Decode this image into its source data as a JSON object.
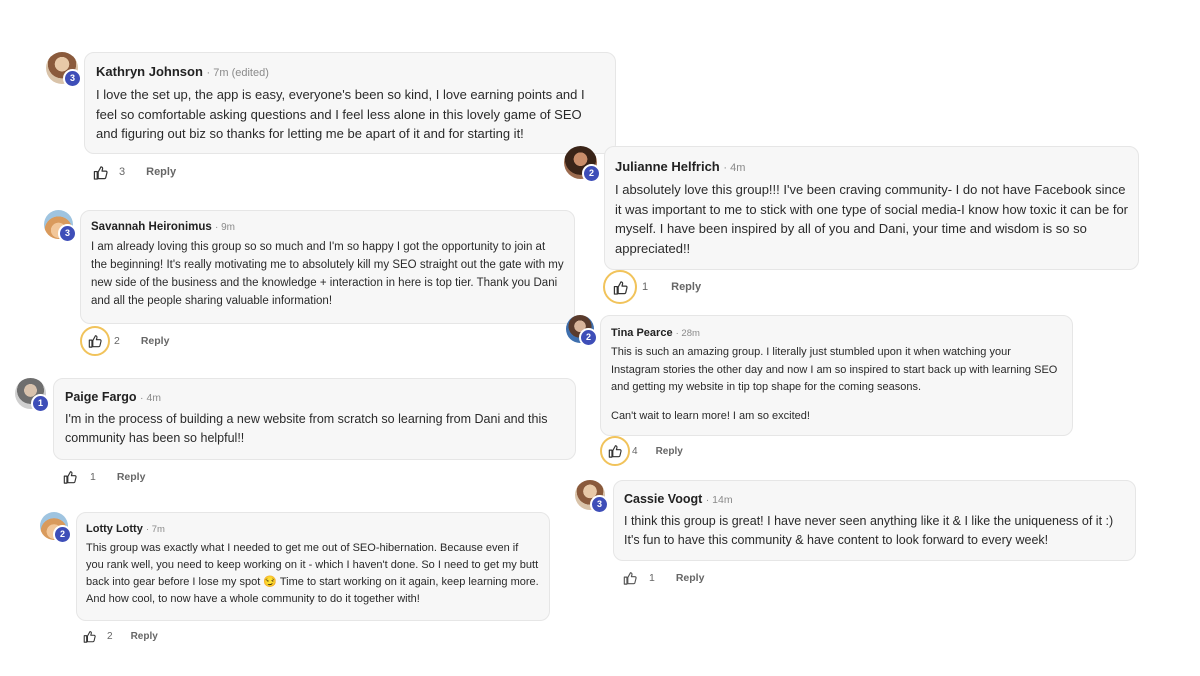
{
  "comments": [
    {
      "author": "Kathryn Johnson",
      "meta": "· 7m (edited)",
      "level": "3",
      "avatar_icon": "profile-photo",
      "text": "I love the set up, the app is easy, everyone's been so kind, I love earning points and I feel so comfortable asking questions and I feel less alone in this lovely game of SEO and figuring out biz so thanks for letting me be apart of it and for starting it!",
      "likes": "3",
      "reply": "Reply"
    },
    {
      "author": "Savannah Heironimus",
      "meta": "· 9m",
      "level": "3",
      "avatar_icon": "profile-photo",
      "text": "I am already loving this group so so much and I'm so happy I got the opportunity to join at the beginning! It's really motivating me to absolutely kill my SEO straight out the gate with my new side of the business and the knowledge + interaction in here is top tier. Thank you Dani and all the people sharing valuable information!",
      "likes": "2",
      "reply": "Reply"
    },
    {
      "author": "Paige Fargo",
      "meta": "· 4m",
      "level": "1",
      "avatar_icon": "profile-photo",
      "text": "I'm in the process of building a new website from scratch so learning from Dani and this community has been so helpful!!",
      "likes": "1",
      "reply": "Reply"
    },
    {
      "author": "Lotty Lotty",
      "meta": "· 7m",
      "level": "2",
      "avatar_icon": "profile-photo",
      "text": "This group was exactly what I needed to get me out of SEO-hibernation. Because even if you rank well, you need to keep working on it - which I haven't done. So I need to get my butt back into gear before I lose my spot 😏 Time to start working on it again, keep learning more. And how cool, to now have a whole community to do it together with!",
      "likes": "2",
      "reply": "Reply"
    },
    {
      "author": "Julianne Helfrich",
      "meta": "· 4m",
      "level": "2",
      "avatar_icon": "profile-photo",
      "text": "I absolutely love this group!!! I've been craving community- I do not have Facebook since it was important to me to stick with one type of social media-I know how toxic it can be for myself. I have been inspired by all of you and Dani, your time and wisdom is so so appreciated!!",
      "likes": "1",
      "reply": "Reply"
    },
    {
      "author": "Tina Pearce",
      "meta": "· 28m",
      "level": "2",
      "avatar_icon": "profile-photo",
      "text": "This is such an amazing group. I literally just stumbled upon it when watching your Instagram stories the other day and now I am so inspired to start back up with learning SEO and getting my website in tip top shape for the coming seasons.",
      "text2": "Can't wait to learn more! I am so excited!",
      "likes": "4",
      "reply": "Reply"
    },
    {
      "author": "Cassie Voogt",
      "meta": "· 14m",
      "level": "3",
      "avatar_icon": "profile-photo",
      "text": "I think this group is great! I have never seen anything like it & I like the uniqueness of it :) It's fun to have this community & have content to look forward to every week!",
      "likes": "1",
      "reply": "Reply"
    }
  ],
  "icons": {
    "like": "thumbs-up-icon"
  },
  "colors": {
    "level_badge": "#3e4eb8",
    "like_ring": "#f1c35b",
    "bubble_bg": "#f7f7f7"
  }
}
